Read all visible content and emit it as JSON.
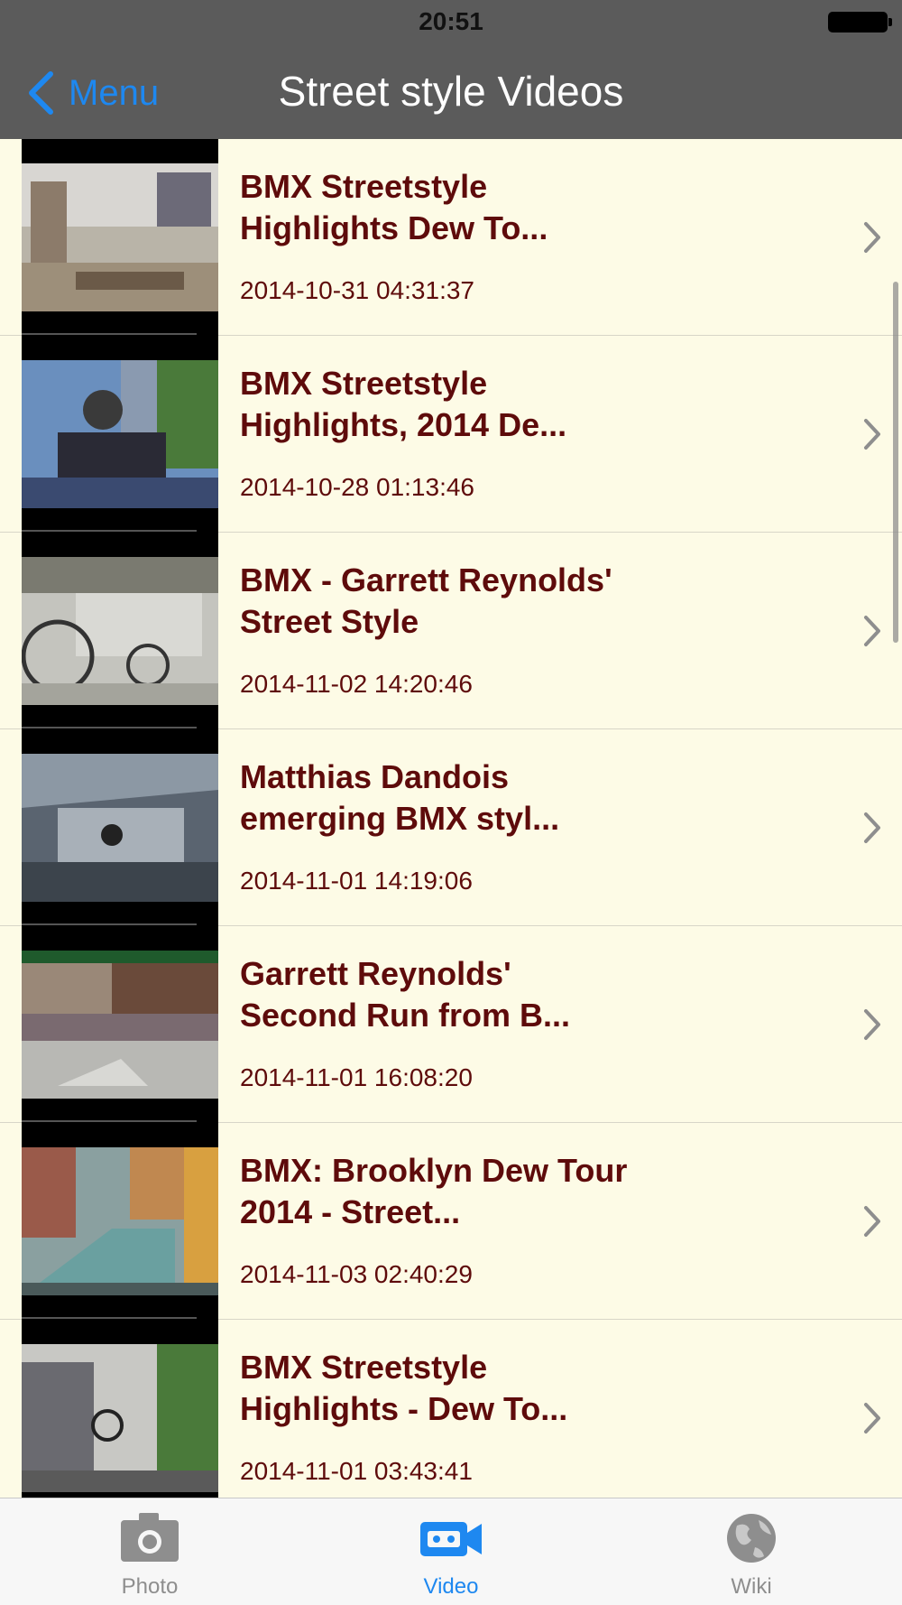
{
  "status_bar": {
    "time": "20:51"
  },
  "nav": {
    "back_label": "Menu",
    "title": "Street style Videos"
  },
  "videos": [
    {
      "title": "BMX Streetstyle Highlights Dew To...",
      "date": "2014-10-31 04:31:37"
    },
    {
      "title": "BMX Streetstyle Highlights, 2014 De...",
      "date": "2014-10-28 01:13:46"
    },
    {
      "title": "BMX - Garrett Reynolds' Street Style",
      "date": "2014-11-02 14:20:46"
    },
    {
      "title": "Matthias Dandois emerging BMX styl...",
      "date": "2014-11-01 14:19:06"
    },
    {
      "title": "Garrett Reynolds' Second Run from B...",
      "date": "2014-11-01 16:08:20"
    },
    {
      "title": "BMX: Brooklyn Dew Tour 2014 - Street...",
      "date": "2014-11-03 02:40:29"
    },
    {
      "title": "BMX Streetstyle Highlights - Dew To...",
      "date": "2014-11-01 03:43:41"
    }
  ],
  "tabs": [
    {
      "label": "Photo",
      "icon": "camera-icon",
      "active": false
    },
    {
      "label": "Video",
      "icon": "video-camera-icon",
      "active": true
    },
    {
      "label": "Wiki",
      "icon": "globe-icon",
      "active": false
    }
  ],
  "colors": {
    "bar_background": "#5b5b5b",
    "accent": "#1e88f0",
    "list_background": "#fdfbe6",
    "title_text": "#5e0b0b"
  }
}
